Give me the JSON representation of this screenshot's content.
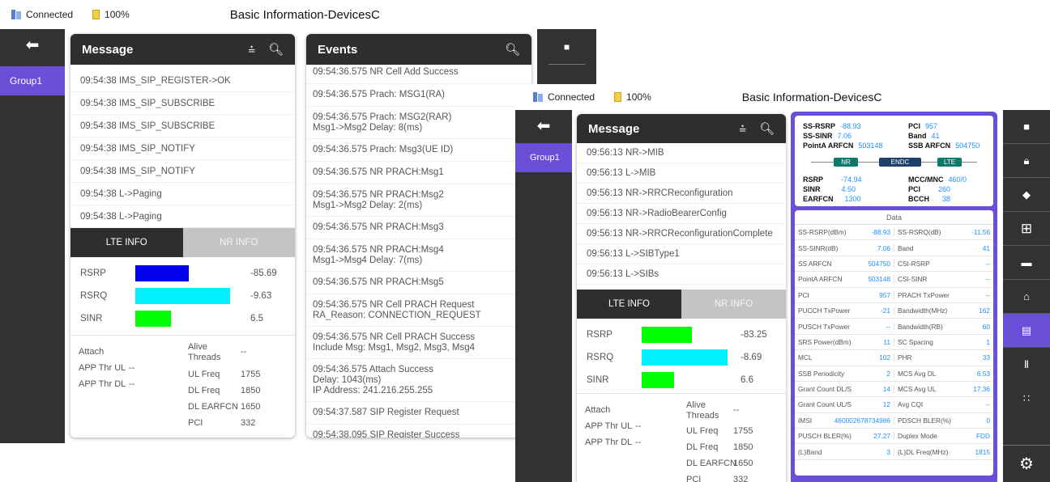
{
  "left": {
    "status": {
      "connected": "Connected",
      "battery": "100%",
      "title": "Basic Information-DevicesC"
    },
    "back_icon": "arrow-back-icon",
    "group": "Group1",
    "message": {
      "title": "Message",
      "rows": [
        "09:54:38  IMS_SIP_REGISTER->OK",
        "09:54:38  IMS_SIP_SUBSCRIBE",
        "09:54:38  IMS_SIP_SUBSCRIBE",
        "09:54:38  IMS_SIP_NOTIFY",
        "09:54:38  IMS_SIP_NOTIFY",
        "09:54:38  L->Paging",
        "09:54:38  L->Paging"
      ]
    },
    "tabs": {
      "lte": "LTE INFO",
      "nr": "NR INFO"
    },
    "bars": [
      {
        "label": "RSRP",
        "value": "-85.69",
        "fill": 0.5,
        "color": "#0000ee"
      },
      {
        "label": "RSRQ",
        "value": "-9.63",
        "fill": 0.89,
        "color": "#00f0ff"
      },
      {
        "label": "SINR",
        "value": "6.5",
        "fill": 0.33,
        "color": "#00ff00"
      }
    ],
    "info": {
      "attach": "Attach",
      "app_ul": "APP Thr UL",
      "app_ul_v": "--",
      "app_dl": "APP Thr DL",
      "app_dl_v": "--",
      "alive": "Alive Threads",
      "alive_v": "--",
      "ulf": "UL Freq",
      "ulf_v": "1755",
      "dlf": "DL Freq",
      "dlf_v": "1850",
      "dle": "DL EARFCN",
      "dle_v": "1650",
      "pci": "PCI",
      "pci_v": "332"
    },
    "events": {
      "title": "Events",
      "items": [
        "09:54:36.575  NR Cell Add Success",
        "09:54:36.575  Prach: MSG1(RA)",
        "09:54:36.575  Prach: MSG2(RAR)\nMsg1->Msg2 Delay: 8(ms)",
        "09:54:36.575  Prach: Msg3(UE ID)",
        "09:54:36.575  NR PRACH:Msg1",
        "09:54:36.575  NR PRACH:Msg2\nMsg1->Msg2 Delay: 2(ms)",
        "09:54:36.575  NR PRACH:Msg3",
        "09:54:36.575  NR PRACH:Msg4\nMsg1->Msg4 Delay: 7(ms)",
        "09:54:36.575  NR PRACH:Msg5",
        "09:54:36.575  NR Cell PRACH Request\nRA_Reason: CONNECTION_REQUEST",
        "09:54:36.575  NR Cell PRACH Success\nInclude Msg: Msg1, Msg2, Msg3, Msg4",
        "09:54:36.575  Attach Success\nDelay: 1043(ms)\nIP Address: 241.216.255.255",
        "09:54:37.587  SIP Register Request",
        "09:54:38.095  SIP Register Success"
      ]
    }
  },
  "right": {
    "status": {
      "connected": "Connected",
      "battery": "100%",
      "title": "Basic Information-DevicesC"
    },
    "group": "Group1",
    "message": {
      "title": "Message",
      "rows": [
        "09:56:13  NR->MIB",
        "09:56:13  L->MIB",
        "09:56:13  NR->RRCReconfiguration",
        "09:56:13  NR->RadioBearerConfig",
        "09:56:13  NR->RRCReconfigurationComplete",
        "09:56:13  L->SIBType1",
        "09:56:13  L->SIBs"
      ]
    },
    "tabs": {
      "lte": "LTE INFO",
      "nr": "NR INFO"
    },
    "bars": [
      {
        "label": "RSRP",
        "value": "-83.25",
        "fill": 0.55,
        "color": "#00ff00"
      },
      {
        "label": "RSRQ",
        "value": "-8.69",
        "fill": 0.95,
        "color": "#00f0ff"
      },
      {
        "label": "SINR",
        "value": "6.6",
        "fill": 0.36,
        "color": "#00ff00"
      }
    ],
    "info": {
      "attach": "Attach",
      "app_ul": "APP Thr UL",
      "app_ul_v": "--",
      "app_dl": "APP Thr DL",
      "app_dl_v": "--",
      "alive": "Alive Threads",
      "alive_v": "--",
      "ulf": "UL Freq",
      "ulf_v": "1755",
      "dlf": "DL Freq",
      "dlf_v": "1850",
      "dle": "DL EARFCN",
      "dle_v": "1650",
      "pci": "PCI",
      "pci_v": "332"
    },
    "top": {
      "ssrsrp": "SS-RSRP",
      "ssrsrp_v": "-88.93",
      "sssinr": "SS-SINR",
      "sssinr_v": "7.06",
      "pointa": "PointA ARFCN",
      "pointa_v": "503148",
      "pci": "PCI",
      "pci_v": "957",
      "band": "Band",
      "band_v": "41",
      "ssb": "SSB ARFCN",
      "ssb_v": "504750",
      "nr": "NR",
      "endc": "ENDC",
      "lte": "LTE",
      "rsrp": "RSRP",
      "rsrp_v": "-74.94",
      "sinr": "SINR",
      "sinr_v": "4.50",
      "earfcn": "EARFCN",
      "earfcn_v": "1300",
      "mcc": "MCC/MNC",
      "mcc_v": "460/0",
      "pci2": "PCI",
      "pci2_v": "260",
      "bcch": "BCCH",
      "bcch_v": "38"
    },
    "data_title": "Data",
    "table": [
      [
        "SS-RSRP(dBm)",
        "-88.93",
        "SS-RSRQ(dB)",
        "-11.56"
      ],
      [
        "SS-SINR(dB)",
        "7.06",
        "Band",
        "41"
      ],
      [
        "SS ARFCN",
        "504750",
        "CSI-RSRP",
        "--"
      ],
      [
        "PointA ARFCN",
        "503148",
        "CSI-SINR",
        "--"
      ],
      [
        "PCI",
        "957",
        "PRACH TxPower",
        "--"
      ],
      [
        "PUCCH TxPower",
        "-21",
        "Bandwidth(MHz)",
        "162"
      ],
      [
        "PUSCH TxPower",
        "--",
        "Bandwidth(RB)",
        "60"
      ],
      [
        "SRS Power(dBm)",
        "11",
        "SC Spacing",
        "1"
      ],
      [
        "MCL",
        "102",
        "PHR",
        "33"
      ],
      [
        "SSB Periodicity",
        "2",
        "MCS Avg DL",
        "6.53"
      ],
      [
        "Grant Count DL/S",
        "14",
        "MCS Avg UL",
        "17.36"
      ],
      [
        "Grant Count UL/S",
        "12",
        "Avg CQI",
        "--"
      ],
      [
        "IMSI",
        "460002678734986",
        "PDSCH BLER(%)",
        "0"
      ],
      [
        "PUSCH BLER(%)",
        "27.27",
        "Duplex Mode",
        "FDD"
      ],
      [
        "(L)Band",
        "3",
        "(L)DL Freq(MHz)",
        "1815"
      ]
    ],
    "icons": [
      "stop-icon",
      "lock-icon",
      "tag-icon",
      "table-icon",
      "folder-icon",
      "map-pin-icon",
      "document-icon",
      "rss-icon",
      "grid-icon",
      "settings-icon"
    ]
  }
}
